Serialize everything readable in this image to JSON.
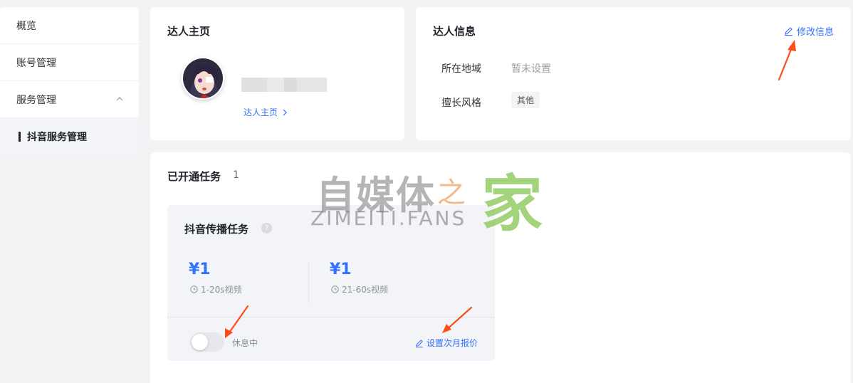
{
  "sidebar": {
    "items": [
      {
        "label": "概览"
      },
      {
        "label": "账号管理"
      },
      {
        "label": "服务管理"
      },
      {
        "label": "抖音服务管理"
      }
    ]
  },
  "profile_card": {
    "title": "达人主页",
    "home_link": "达人主页"
  },
  "info_card": {
    "title": "达人信息",
    "edit_label": "修改信息",
    "region_label": "所在地域",
    "region_value": "暂未设置",
    "style_label": "擅长风格",
    "style_value": "其他"
  },
  "tasks": {
    "title": "已开通任务",
    "count": "1",
    "task": {
      "name": "抖音传播任务",
      "help": "?",
      "price1": "¥1",
      "price1_sub": "1-20s视频",
      "price2": "¥1",
      "price2_sub": "21-60s视频",
      "toggle_label": "休息中",
      "set_price_label": "设置次月报价"
    }
  },
  "watermark": {
    "cn": "自媒体",
    "zhi": "之",
    "jia": "家",
    "en": "ZIMEITI.FANS"
  },
  "colors": {
    "accent": "#3370ff",
    "annotation": "#ff4d1a"
  }
}
